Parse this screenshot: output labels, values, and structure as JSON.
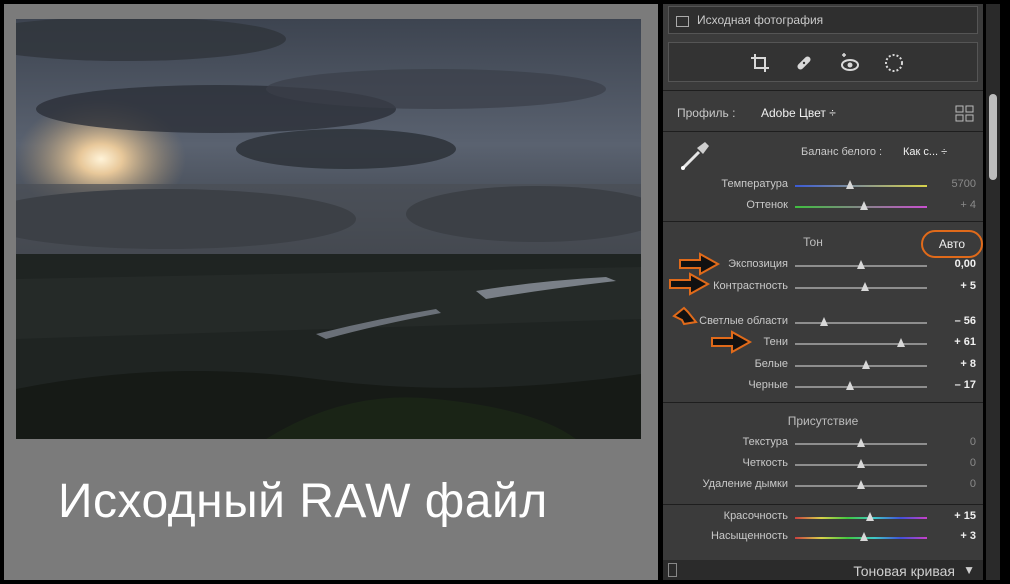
{
  "caption": "Исходный RAW файл",
  "panel": {
    "original_photo_label": "Исходная фотография",
    "tools": [
      "crop-icon",
      "heal-icon",
      "red-eye-icon",
      "mask-icon"
    ],
    "profile_label": "Профиль :",
    "profile_value": "Adobe Цвет ÷",
    "white_balance_label": "Баланс белого :",
    "white_balance_value": "Как с... ÷",
    "wb_sliders": [
      {
        "label": "Температура",
        "value": "5700",
        "level": 0.42
      },
      {
        "label": "Оттенок",
        "value": "+ 4",
        "level": 0.52
      }
    ],
    "tone_title": "Тон",
    "auto_label": "Авто",
    "tone_sliders": [
      {
        "label": "Экспозиция",
        "value": "0,00",
        "level": 0.5
      },
      {
        "label": "Контрастность",
        "value": "+ 5",
        "level": 0.53
      },
      {
        "label": "Светлые области",
        "value": "– 56",
        "level": 0.22
      },
      {
        "label": "Тени",
        "value": "+ 61",
        "level": 0.8
      },
      {
        "label": "Белые",
        "value": "+ 8",
        "level": 0.54
      },
      {
        "label": "Черные",
        "value": "– 17",
        "level": 0.42
      }
    ],
    "presence_title": "Присутствие",
    "presence_sliders": [
      {
        "label": "Текстура",
        "value": "0",
        "level": 0.5
      },
      {
        "label": "Четкость",
        "value": "0",
        "level": 0.5
      },
      {
        "label": "Удаление дымки",
        "value": "0",
        "level": 0.5
      }
    ],
    "color_sliders": [
      {
        "label": "Красочность",
        "value": "+ 15",
        "level": 0.57
      },
      {
        "label": "Насыщенность",
        "value": "+ 3",
        "level": 0.52
      }
    ],
    "tone_curve_label": "Тоновая кривая",
    "accent_color": "#e06a1a"
  }
}
